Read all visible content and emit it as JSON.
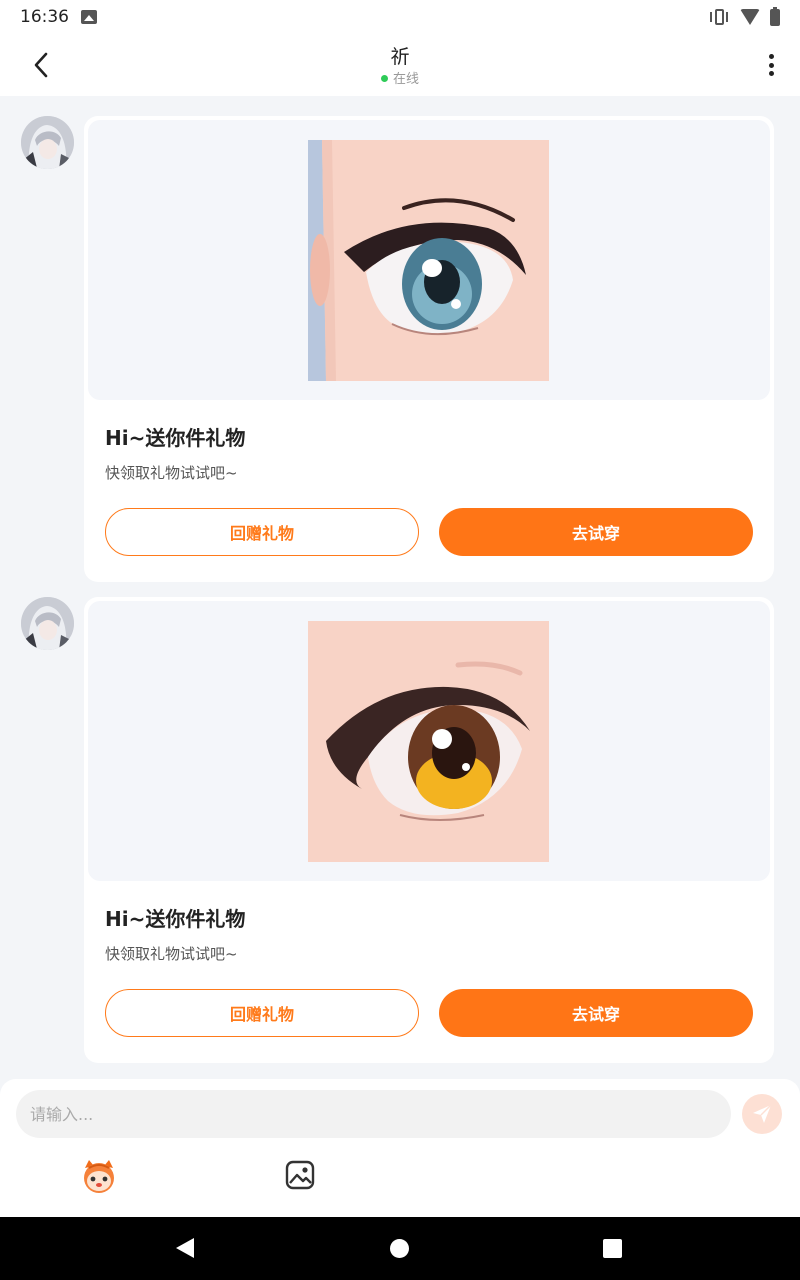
{
  "status_bar": {
    "time": "16:36"
  },
  "header": {
    "title": "祈",
    "status": "在线"
  },
  "messages": [
    {
      "title": "Hi~送你件礼物",
      "subtitle": "快领取礼物试试吧~",
      "secondary_button": "回赠礼物",
      "primary_button": "去试穿",
      "image_icon": "blue-eye-image"
    },
    {
      "title": "Hi~送你件礼物",
      "subtitle": "快领取礼物试试吧~",
      "secondary_button": "回赠礼物",
      "primary_button": "去试穿",
      "image_icon": "amber-eye-image"
    }
  ],
  "composer": {
    "placeholder": "请输入..."
  },
  "colors": {
    "accent": "#ff7516",
    "online": "#2ecb58",
    "send_disabled": "#fde0d4"
  }
}
